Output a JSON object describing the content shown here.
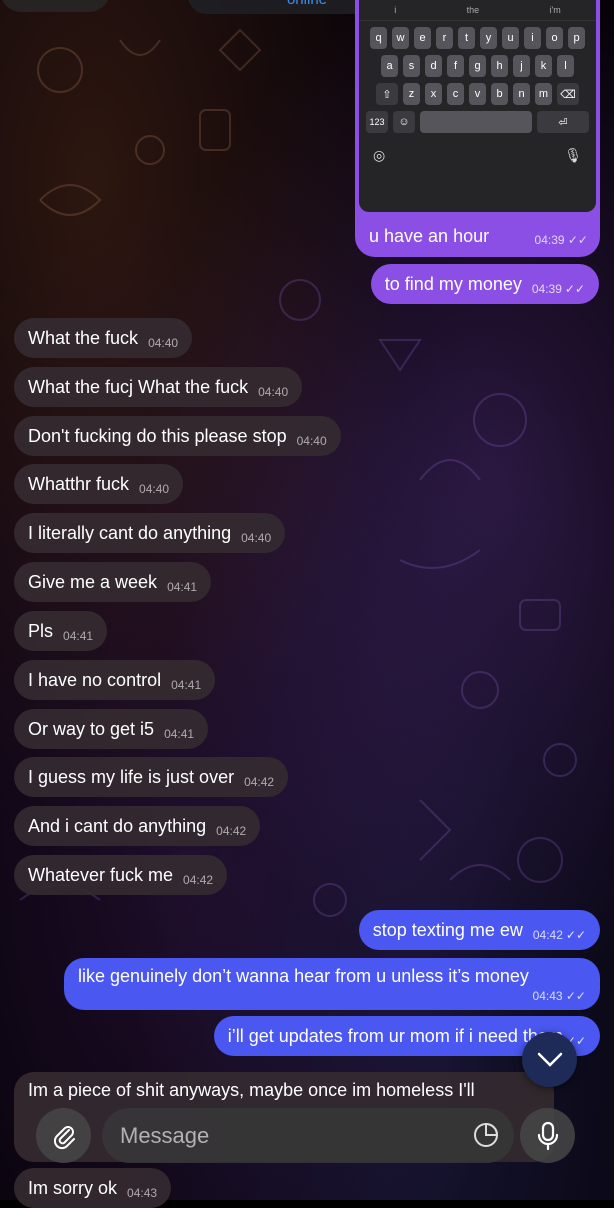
{
  "header": {
    "status": "online"
  },
  "keyboard": {
    "suggestions": [
      "i",
      "the",
      "i'm"
    ],
    "rows": [
      [
        "q",
        "w",
        "e",
        "r",
        "t",
        "y",
        "u",
        "i",
        "o",
        "p"
      ],
      [
        "a",
        "s",
        "d",
        "f",
        "g",
        "h",
        "j",
        "k",
        "l"
      ],
      [
        "z",
        "x",
        "c",
        "v",
        "b",
        "n",
        "m"
      ]
    ],
    "numbers_key": "123"
  },
  "messages": [
    {
      "dir": "out",
      "text": "u have an hour",
      "time": "04:39",
      "color": "#8b4fe6"
    },
    {
      "dir": "out",
      "text": "to find my money",
      "time": "04:39",
      "color": "#8b4fe6"
    },
    {
      "dir": "in",
      "text": "What the fuck",
      "time": "04:40"
    },
    {
      "dir": "in",
      "text": "What the fucj What the fuck",
      "time": "04:40"
    },
    {
      "dir": "in",
      "text": "Don't fucking do this please stop",
      "time": "04:40"
    },
    {
      "dir": "in",
      "text": "Whatthr fuck",
      "time": "04:40"
    },
    {
      "dir": "in",
      "text": "I literally cant do anything",
      "time": "04:40"
    },
    {
      "dir": "in",
      "text": "Give me a week",
      "time": "04:41"
    },
    {
      "dir": "in",
      "text": "Pls",
      "time": "04:41"
    },
    {
      "dir": "in",
      "text": "I have no control",
      "time": "04:41"
    },
    {
      "dir": "in",
      "text": "Or way to get i5",
      "time": "04:41"
    },
    {
      "dir": "in",
      "text": "I guess my life is just over",
      "time": "04:42"
    },
    {
      "dir": "in",
      "text": "And i cant do anything",
      "time": "04:42"
    },
    {
      "dir": "in",
      "text": "Whatever fuck me",
      "time": "04:42"
    },
    {
      "dir": "out",
      "text": "stop texting me ew",
      "time": "04:42",
      "color": "#4a57f0"
    },
    {
      "dir": "out",
      "text": "like genuinely don’t wanna hear from u unless it’s money",
      "time": "04:43",
      "color": "#4a57f0"
    },
    {
      "dir": "out",
      "text": "i’ll get updates from ur mom if i need them",
      "time": "",
      "color": "#4a57f0"
    },
    {
      "dir": "in",
      "text": "Im a piece of shit anyways,  maybe once im homeless I'll",
      "time": ""
    },
    {
      "dir": "in",
      "text": "Im sorry ok",
      "time": "04:43"
    }
  ],
  "composer": {
    "placeholder": "Message"
  },
  "colors": {
    "purple": "#8b4fe6",
    "blue": "#4a57f0",
    "incoming": "#342a30"
  },
  "icons": [
    "paperclip-icon",
    "sticker-icon",
    "microphone-icon",
    "chevron-down-icon",
    "globe-icon",
    "shift-icon",
    "backspace-icon",
    "emoji-icon"
  ]
}
